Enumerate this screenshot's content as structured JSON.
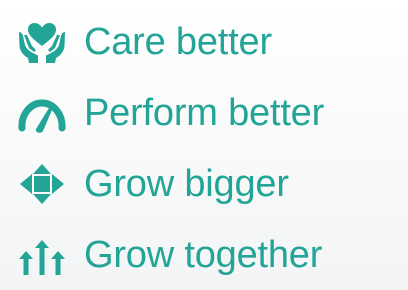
{
  "accent_color": "#22a596",
  "items": [
    {
      "icon": "hands-heart-icon",
      "label": "Care better"
    },
    {
      "icon": "speedometer-icon",
      "label": "Perform better"
    },
    {
      "icon": "move-arrows-icon",
      "label": "Grow bigger"
    },
    {
      "icon": "up-arrows-icon",
      "label": "Grow together"
    }
  ]
}
